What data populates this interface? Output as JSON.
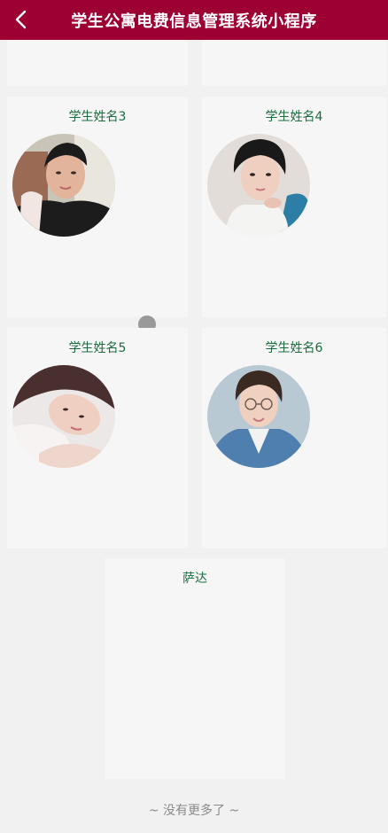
{
  "header": {
    "title": "学生公寓电费信息管理系统小程序",
    "back_icon": "chevron-left-icon"
  },
  "students": [
    {
      "name": "学生姓名3"
    },
    {
      "name": "学生姓名4"
    },
    {
      "name": "学生姓名5"
    },
    {
      "name": "学生姓名6"
    },
    {
      "name": "萨达"
    }
  ],
  "footer": {
    "text": "~ 没有更多了 ~"
  },
  "colors": {
    "header": "#9d0033",
    "name": "#1a6b3d",
    "card": "#f7f6f6",
    "page": "#f2f1f1"
  }
}
